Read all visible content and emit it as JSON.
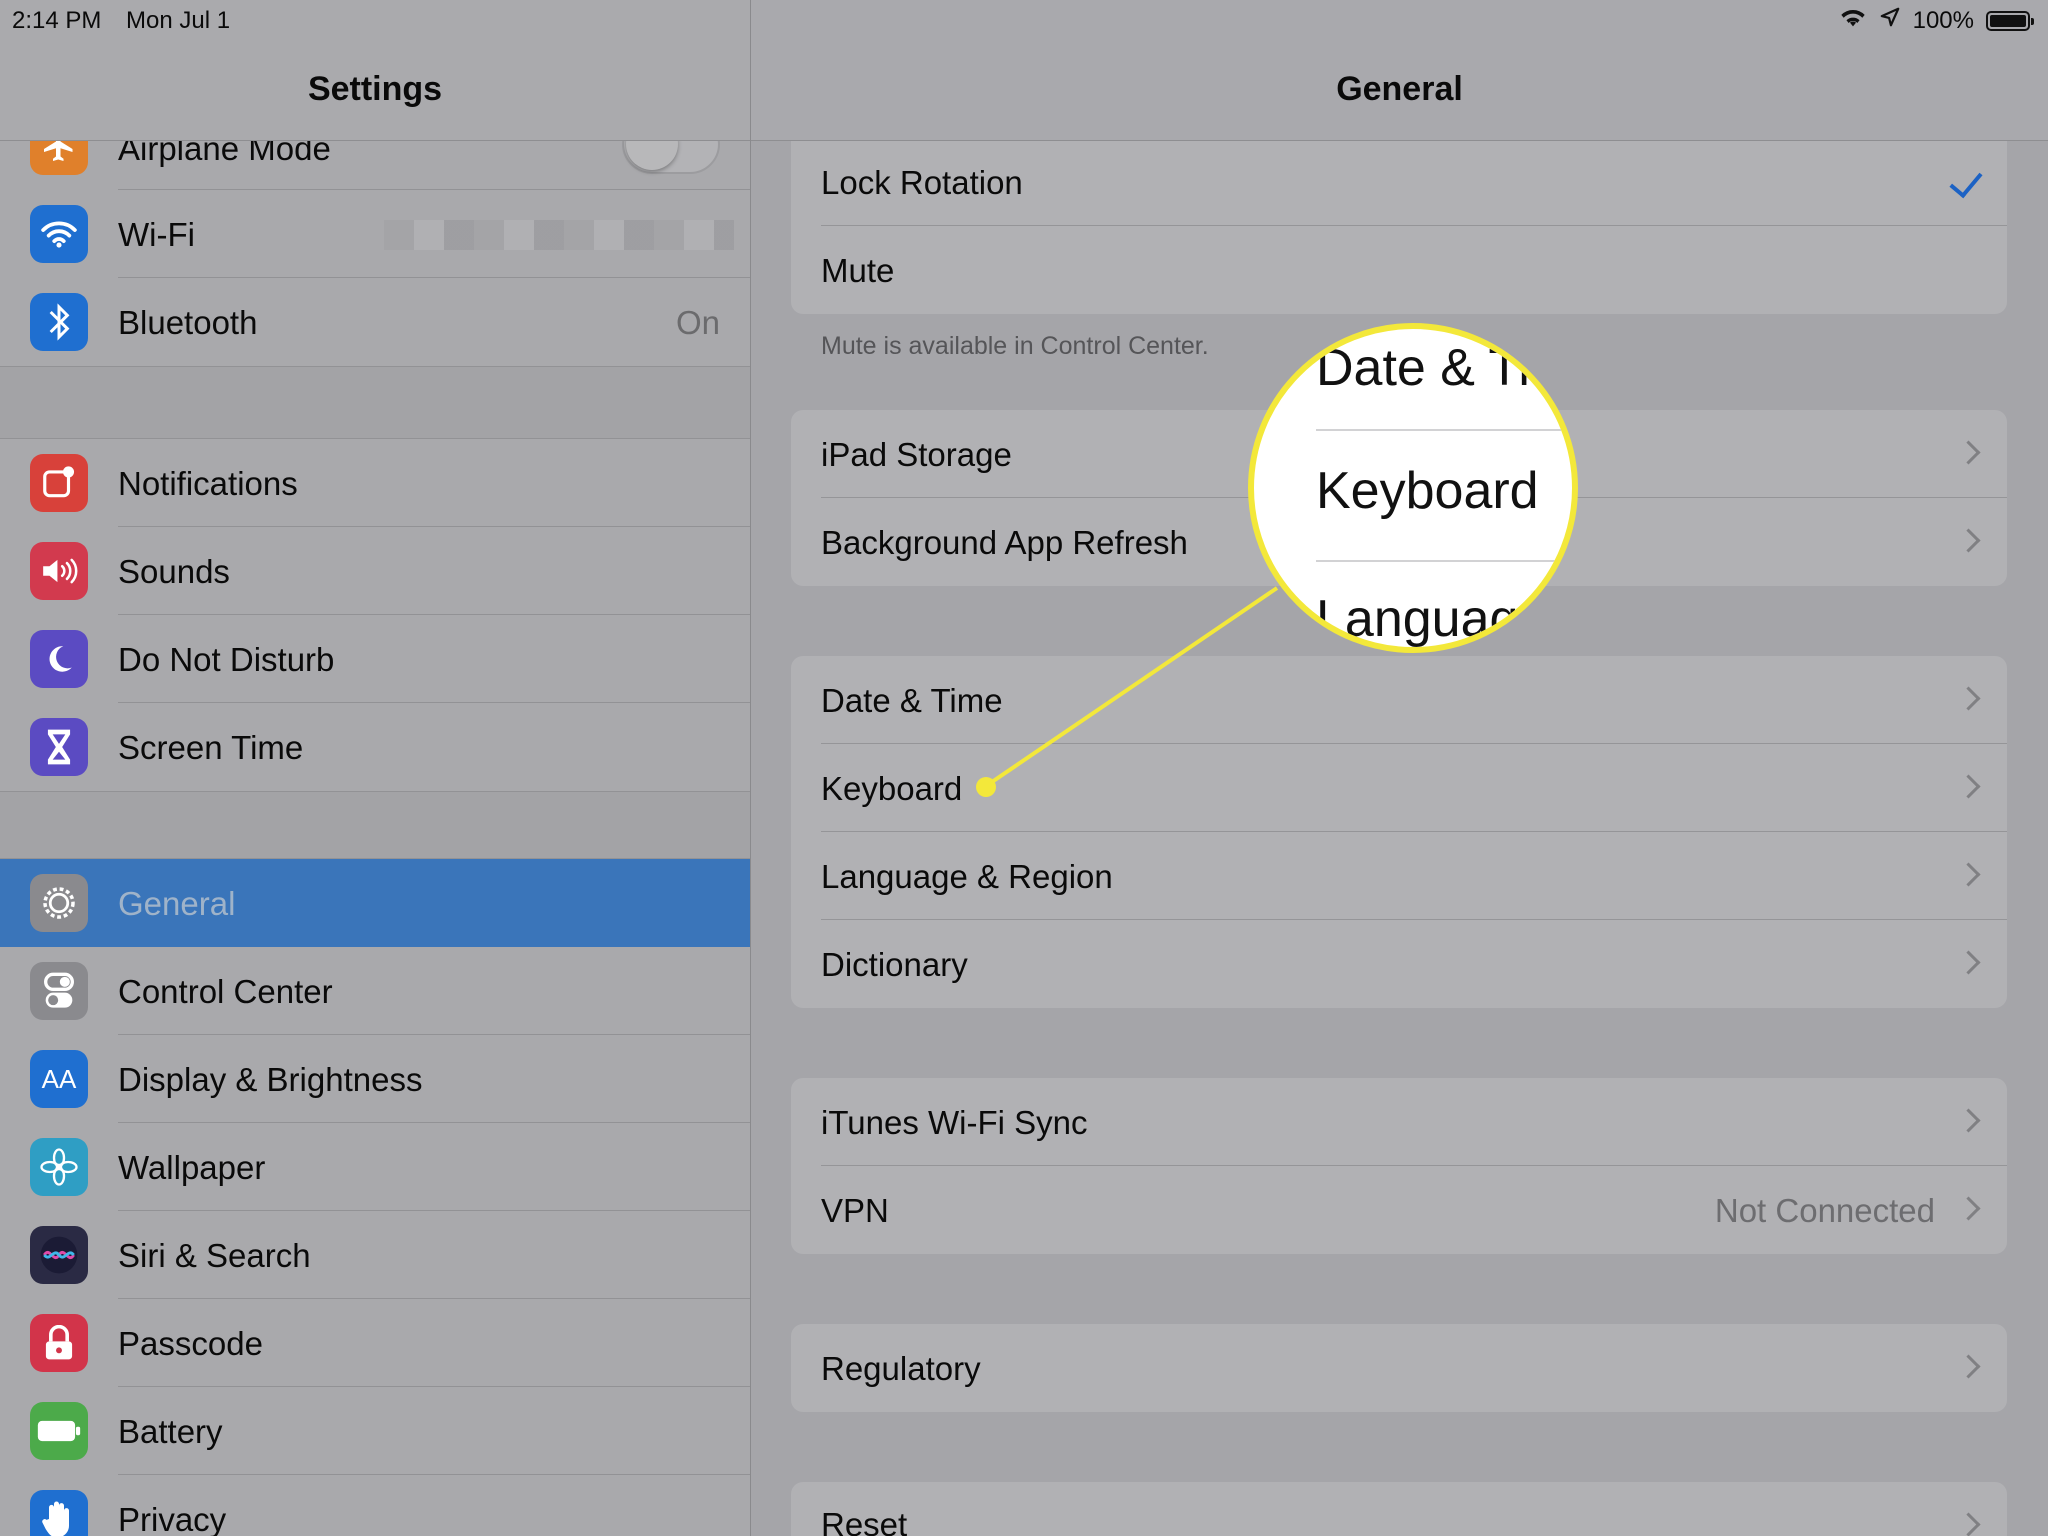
{
  "status_bar": {
    "time": "2:14 PM",
    "date": "Mon Jul 1",
    "battery": "100%"
  },
  "left_pane": {
    "title": "Settings",
    "group1": [
      {
        "label": "Airplane Mode",
        "icon": "airplane-icon",
        "color": "#e0802b"
      },
      {
        "label": "Wi-Fi",
        "icon": "wifi-icon",
        "color": "#1f6fd0"
      },
      {
        "label": "Bluetooth",
        "icon": "bluetooth-icon",
        "color": "#1f6fd0",
        "value": "On"
      }
    ],
    "group2": [
      {
        "label": "Notifications",
        "icon": "notifications-icon",
        "color": "#d8413a"
      },
      {
        "label": "Sounds",
        "icon": "speaker-icon",
        "color": "#d23a4e"
      },
      {
        "label": "Do Not Disturb",
        "icon": "moon-icon",
        "color": "#5b4bc2"
      },
      {
        "label": "Screen Time",
        "icon": "hourglass-icon",
        "color": "#5b4bc2"
      }
    ],
    "group3": [
      {
        "label": "General",
        "icon": "gear-icon",
        "color": "#8a8a8e"
      },
      {
        "label": "Control Center",
        "icon": "switches-icon",
        "color": "#8a8a8e"
      },
      {
        "label": "Display & Brightness",
        "icon": "text-size-icon",
        "color": "#1f6fd0",
        "glyph": "AA"
      },
      {
        "label": "Wallpaper",
        "icon": "flower-icon",
        "color": "#2f9ec4"
      },
      {
        "label": "Siri & Search",
        "icon": "siri-icon",
        "color": "#2a2a44"
      },
      {
        "label": "Passcode",
        "icon": "lock-icon",
        "color": "#d2344a"
      },
      {
        "label": "Battery",
        "icon": "battery-icon",
        "color": "#4caa4a"
      },
      {
        "label": "Privacy",
        "icon": "hand-icon",
        "color": "#1f6fd0"
      }
    ]
  },
  "right_pane": {
    "title": "General",
    "card1": [
      {
        "label": "Lock Rotation"
      },
      {
        "label": "Mute"
      }
    ],
    "footnote": "Mute is available in Control Center.",
    "card2": [
      {
        "label": "iPad Storage"
      },
      {
        "label": "Background App Refresh"
      }
    ],
    "card3": [
      {
        "label": "Date & Time"
      },
      {
        "label": "Keyboard"
      },
      {
        "label": "Language & Region"
      },
      {
        "label": "Dictionary"
      }
    ],
    "card4": [
      {
        "label": "iTunes Wi-Fi Sync"
      },
      {
        "label": "VPN",
        "value": "Not Connected"
      }
    ],
    "card5": [
      {
        "label": "Regulatory"
      }
    ],
    "card6": [
      {
        "label": "Reset"
      }
    ]
  },
  "magnifier": {
    "top": "Date & Ti",
    "middle": "Keyboard",
    "bottom": "Languag"
  },
  "colors": {
    "highlight": "#f3e83a",
    "selected": "#3a75ba",
    "check": "#1c62c4"
  }
}
